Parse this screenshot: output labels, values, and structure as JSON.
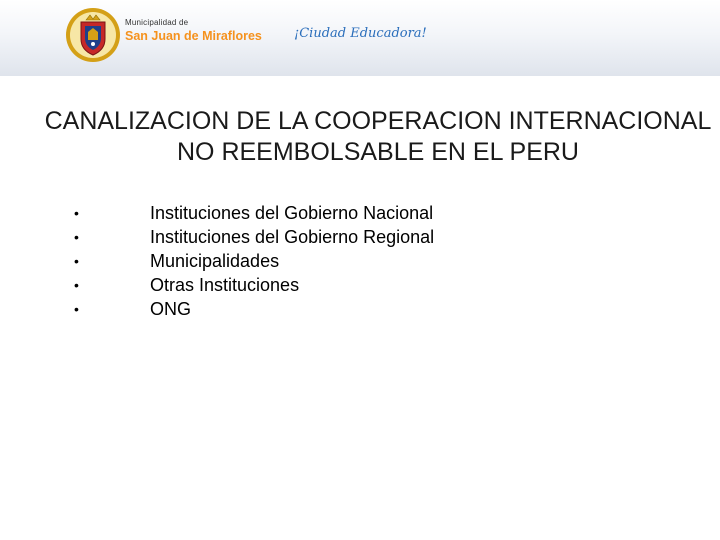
{
  "header": {
    "logo": {
      "icon": "municipal-crest-icon",
      "line1": "Municipalidad de",
      "line2": "San Juan de Miraflores"
    },
    "slogan": "¡Ciudad Educadora!"
  },
  "slide": {
    "title": "CANALIZACION DE LA COOPERACION INTERNACIONAL NO REEMBOLSABLE EN EL PERU",
    "bullets": [
      "Instituciones del Gobierno Nacional",
      "Instituciones del Gobierno Regional",
      "Municipalidades",
      "Otras Instituciones",
      "ONG"
    ]
  },
  "colors": {
    "brand_orange": "#f5921e",
    "slogan_blue": "#2a6ebb",
    "crest_red": "#c62828",
    "crest_gold": "#d4a017"
  }
}
